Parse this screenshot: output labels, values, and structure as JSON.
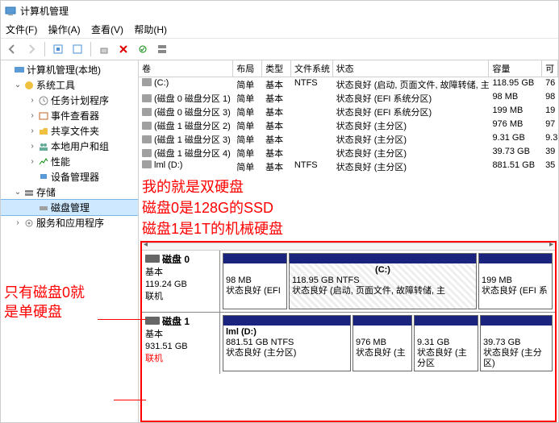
{
  "title": "计算机管理",
  "menu": {
    "file": "文件(F)",
    "action": "操作(A)",
    "view": "查看(V)",
    "help": "帮助(H)"
  },
  "tree": {
    "root": "计算机管理(本地)",
    "systools": "系统工具",
    "task": "任务计划程序",
    "event": "事件查看器",
    "shared": "共享文件夹",
    "users": "本地用户和组",
    "perf": "性能",
    "devmgr": "设备管理器",
    "storage": "存储",
    "diskmgmt": "磁盘管理",
    "services": "服务和应用程序"
  },
  "columns": {
    "vol": "卷",
    "layout": "布局",
    "type": "类型",
    "fs": "文件系统",
    "status": "状态",
    "cap": "容量",
    "free": "可"
  },
  "volumes": [
    {
      "name": "(C:)",
      "layout": "简单",
      "type": "基本",
      "fs": "NTFS",
      "status": "状态良好 (启动, 页面文件, 故障转储, 主分区)",
      "cap": "118.95 GB",
      "free": "76"
    },
    {
      "name": "(磁盘 0 磁盘分区 1)",
      "layout": "简单",
      "type": "基本",
      "fs": "",
      "status": "状态良好 (EFI 系统分区)",
      "cap": "98 MB",
      "free": "98"
    },
    {
      "name": "(磁盘 0 磁盘分区 3)",
      "layout": "简单",
      "type": "基本",
      "fs": "",
      "status": "状态良好 (EFI 系统分区)",
      "cap": "199 MB",
      "free": "19"
    },
    {
      "name": "(磁盘 1 磁盘分区 2)",
      "layout": "简单",
      "type": "基本",
      "fs": "",
      "status": "状态良好 (主分区)",
      "cap": "976 MB",
      "free": "97"
    },
    {
      "name": "(磁盘 1 磁盘分区 3)",
      "layout": "简单",
      "type": "基本",
      "fs": "",
      "status": "状态良好 (主分区)",
      "cap": "9.31 GB",
      "free": "9.3"
    },
    {
      "name": "(磁盘 1 磁盘分区 4)",
      "layout": "简单",
      "type": "基本",
      "fs": "",
      "status": "状态良好 (主分区)",
      "cap": "39.73 GB",
      "free": "39"
    },
    {
      "name": "lml (D:)",
      "layout": "简单",
      "type": "基本",
      "fs": "NTFS",
      "status": "状态良好 (主分区)",
      "cap": "881.51 GB",
      "free": "35"
    }
  ],
  "annotation_main": {
    "l1": "我的就是双硬盘",
    "l2": "磁盘0是128G的SSD",
    "l3": "磁盘1是1T的机械硬盘"
  },
  "annotation_side": {
    "l1": "只有磁盘0就",
    "l2": "是单硬盘"
  },
  "disk0": {
    "title": "磁盘 0",
    "type": "基本",
    "size": "119.24 GB",
    "status": "联机",
    "p1": {
      "size": "98 MB",
      "stat": "状态良好 (EFI"
    },
    "p2": {
      "label": "(C:)",
      "size": "118.95 GB NTFS",
      "stat": "状态良好 (启动, 页面文件, 故障转储, 主"
    },
    "p3": {
      "size": "199 MB",
      "stat": "状态良好 (EFI 系"
    }
  },
  "disk1": {
    "title": "磁盘 1",
    "type": "基本",
    "size": "931.51 GB",
    "status": "联机",
    "p1": {
      "label": "lml  (D:)",
      "size": "881.51 GB NTFS",
      "stat": "状态良好 (主分区)"
    },
    "p2": {
      "size": "976 MB",
      "stat": "状态良好 (主"
    },
    "p3": {
      "size": "9.31 GB",
      "stat": "状态良好 (主分区"
    },
    "p4": {
      "size": "39.73 GB",
      "stat": "状态良好 (主分区)"
    }
  }
}
